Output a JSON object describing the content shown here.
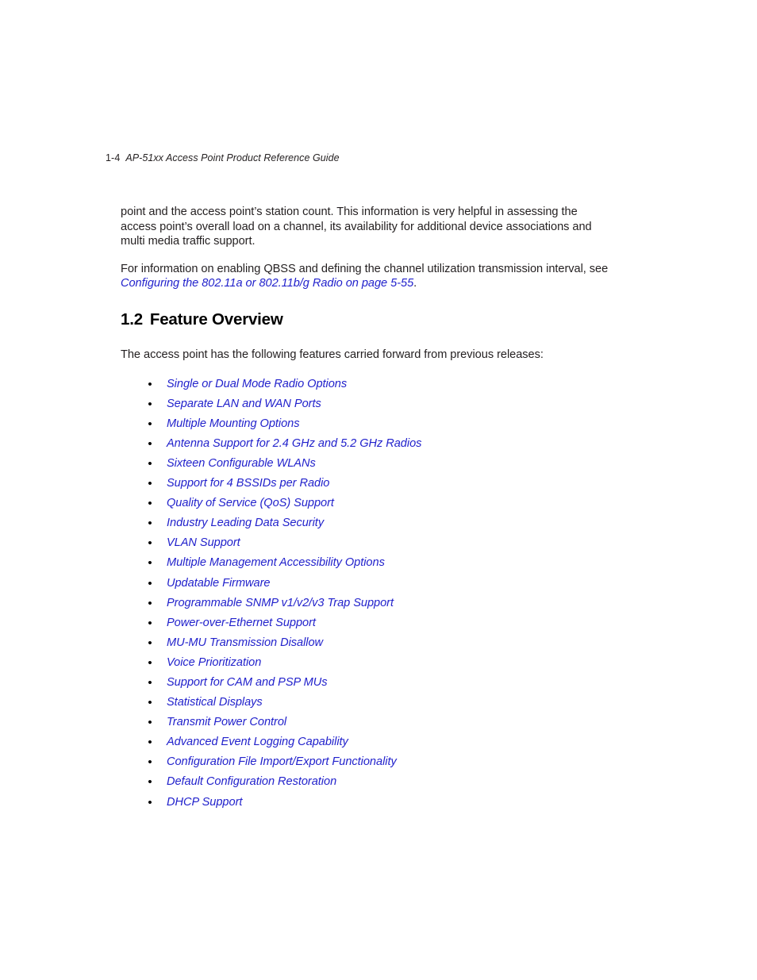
{
  "page": {
    "background_color": "#ffffff",
    "text_color": "#231f20",
    "link_color": "#2222cc"
  },
  "header": {
    "folio": "1-4",
    "doc_title": "AP-51xx Access Point Product Reference Guide"
  },
  "body": {
    "paragraph_1": "point and the access point’s station count. This information is very helpful in assessing the access point’s overall load on a channel, its availability for additional device associations and multi media traffic support.",
    "paragraph_2_lead": "For information on enabling QBSS and defining the channel utilization transmission interval, see ",
    "paragraph_2_xref": "Configuring the 802.11a or 802.11b/g Radio on page 5-55",
    "paragraph_2_tail": "."
  },
  "section": {
    "number": "1.2",
    "title": "Feature Overview",
    "lead_in": "The access point has the following features carried forward from previous releases:"
  },
  "features": {
    "bullet_glyph": "•",
    "items": [
      {
        "label": "Single or Dual Mode Radio Options"
      },
      {
        "label": "Separate LAN and WAN Ports"
      },
      {
        "label": "Multiple Mounting Options"
      },
      {
        "label": "Antenna Support for 2.4 GHz and 5.2 GHz Radios"
      },
      {
        "label": "Sixteen Configurable WLANs"
      },
      {
        "label": "Support for 4 BSSIDs per Radio"
      },
      {
        "label": "Quality of Service (QoS) Support"
      },
      {
        "label": "Industry Leading Data Security"
      },
      {
        "label": "VLAN Support"
      },
      {
        "label": "Multiple Management Accessibility Options"
      },
      {
        "label": "Updatable Firmware"
      },
      {
        "label": "Programmable SNMP v1/v2/v3 Trap Support"
      },
      {
        "label": "Power-over-Ethernet Support"
      },
      {
        "label": "MU-MU Transmission Disallow"
      },
      {
        "label": "Voice Prioritization"
      },
      {
        "label": "Support for CAM and PSP MUs"
      },
      {
        "label": "Statistical Displays"
      },
      {
        "label": "Transmit Power Control"
      },
      {
        "label": "Advanced Event Logging Capability"
      },
      {
        "label": "Configuration File Import/Export Functionality"
      },
      {
        "label": "Default Configuration Restoration"
      },
      {
        "label": "DHCP Support"
      }
    ]
  }
}
